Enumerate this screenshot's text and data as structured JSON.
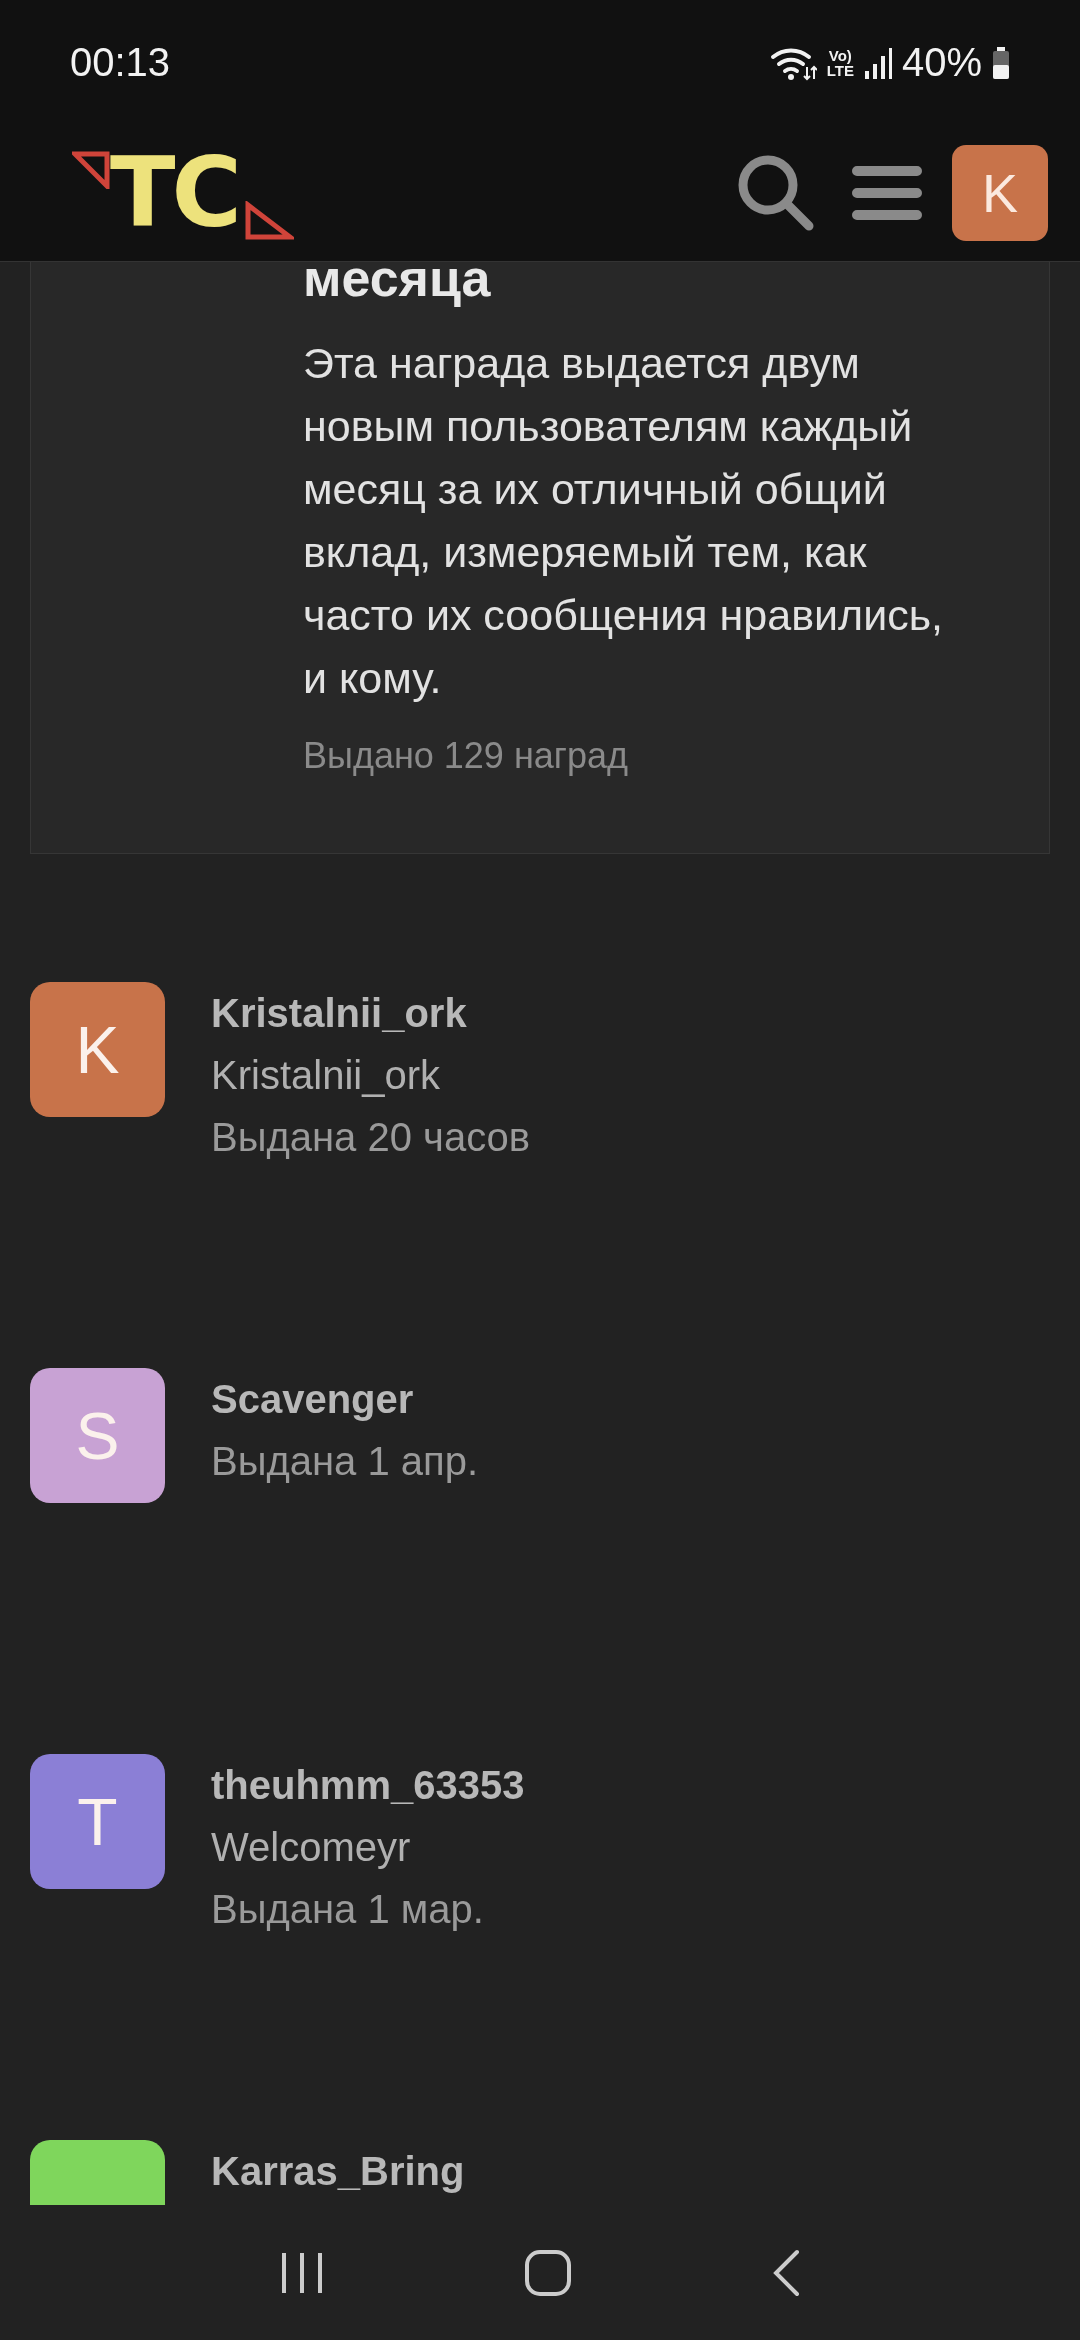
{
  "status_bar": {
    "time": "00:13",
    "network_top": "Vo)",
    "network_bottom": "LTE",
    "battery": "40%"
  },
  "header": {
    "logo": "TC",
    "avatar_letter": "K"
  },
  "award": {
    "title": "месяца",
    "description": "Эта награда выдается двум новым пользователям каждый месяц за их отличный общий вклад, измеряемый тем, как часто их сообщения нравились, и кому.",
    "granted": "Выдано 129 наград"
  },
  "recipients": [
    {
      "letter": "K",
      "color": "#c8734a",
      "name": "Kristalnii_ork",
      "username": "Kristalnii_ork",
      "granted": "Выдана 20 часов"
    },
    {
      "letter": "S",
      "color": "#c8a2d4",
      "name": "Scavenger",
      "granted": "Выдана 1 апр."
    },
    {
      "letter": "T",
      "color": "#8b7fd6",
      "name": "theuhmm_63353",
      "username": "Welcomeyr",
      "granted": "Выдана 1 мар."
    },
    {
      "color": "#7fd65c",
      "name": "Karras_Bring"
    }
  ]
}
